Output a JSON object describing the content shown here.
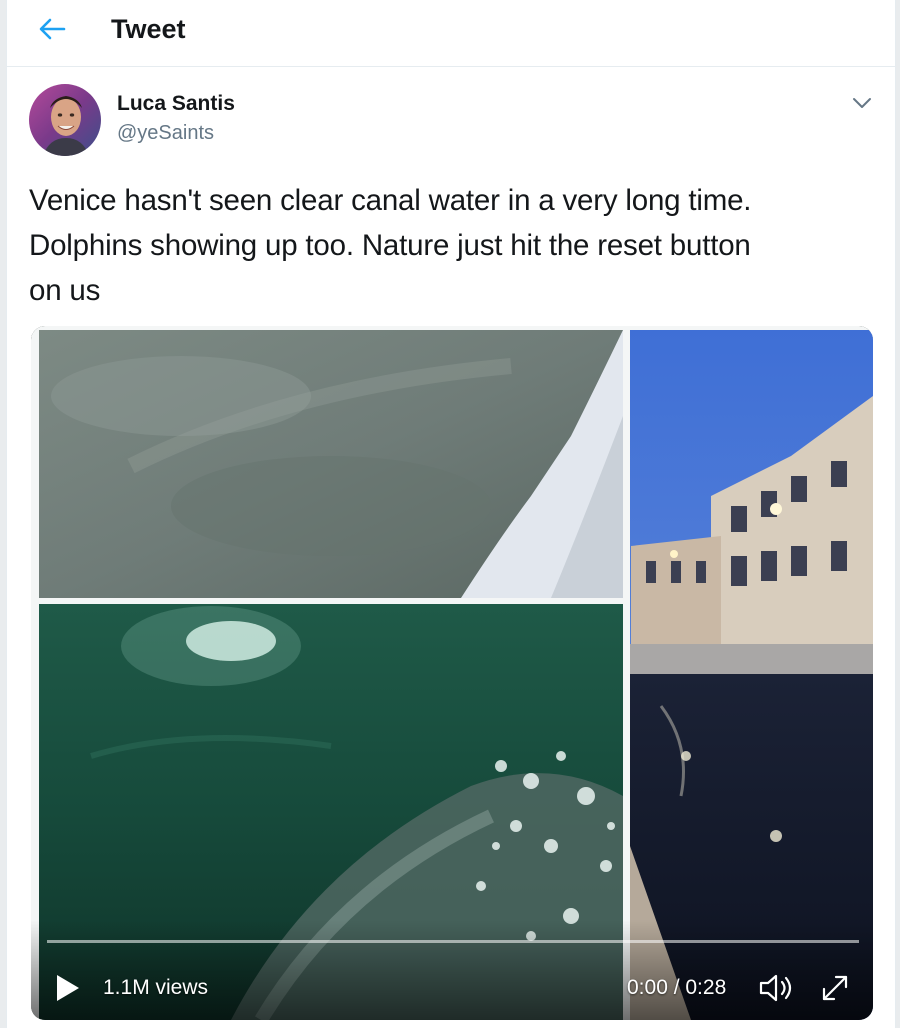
{
  "header": {
    "back_icon": "arrow-left-icon",
    "title": "Tweet"
  },
  "tweet": {
    "author_name": "Luca Santis",
    "author_handle": "@yeSaints",
    "menu_icon": "chevron-down-icon",
    "text": "Venice hasn't seen clear canal water in a very long time.\nDolphins showing up too. Nature just hit the reset button\non us"
  },
  "media": {
    "type": "video",
    "views": "1.1M views",
    "time": "0:00 / 0:28",
    "progress": 0.0,
    "icons": {
      "play": "play-icon",
      "volume": "volume-icon",
      "fullscreen": "fullscreen-icon"
    }
  },
  "colors": {
    "accent": "#1da1f2",
    "text": "#14171a",
    "secondary_text": "#657786",
    "border": "#e6ecf0"
  }
}
